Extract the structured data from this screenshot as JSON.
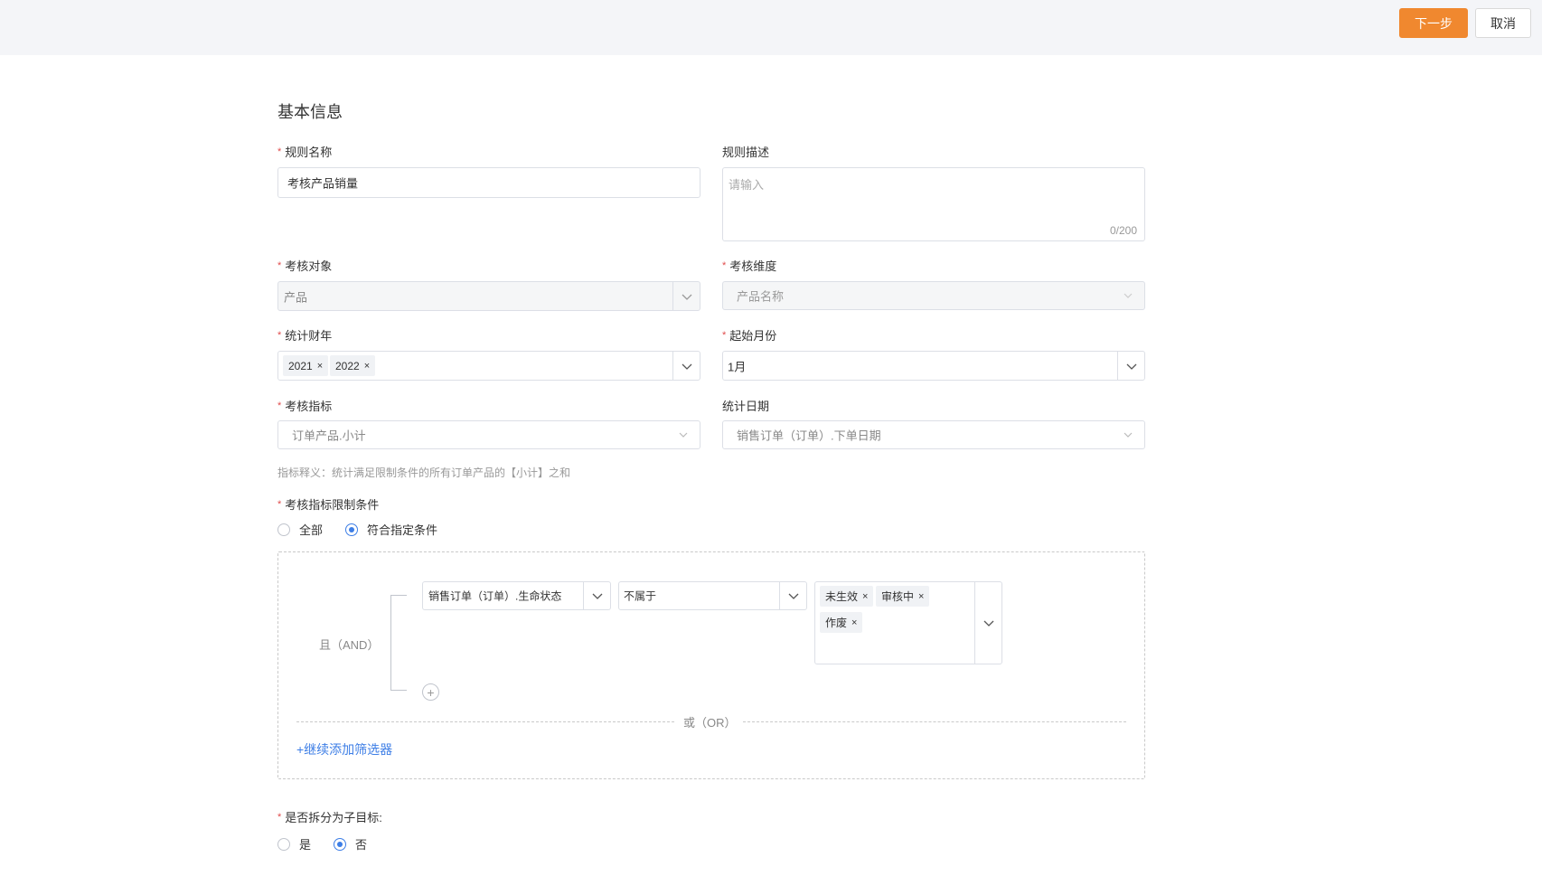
{
  "toolbar": {
    "next_label": "下一步",
    "cancel_label": "取消"
  },
  "section_title": "基本信息",
  "fields": {
    "rule_name": {
      "label": "规则名称",
      "value": "考核产品销量"
    },
    "rule_desc": {
      "label": "规则描述",
      "placeholder": "请输入",
      "counter": "0/200"
    },
    "assess_object": {
      "label": "考核对象",
      "value": "产品"
    },
    "assess_dimension": {
      "label": "考核维度",
      "value": "产品名称"
    },
    "fiscal_year": {
      "label": "统计财年",
      "tags": [
        "2021",
        "2022"
      ]
    },
    "start_month": {
      "label": "起始月份",
      "value": "1月"
    },
    "assess_metric": {
      "label": "考核指标",
      "value": "订单产品.小计"
    },
    "stat_date": {
      "label": "统计日期",
      "value": "销售订单（订单）.下单日期"
    }
  },
  "metric_hint": "指标释义：统计满足限制条件的所有订单产品的【小计】之和",
  "condition": {
    "label": "考核指标限制条件",
    "options": [
      "全部",
      "符合指定条件"
    ],
    "selected": "符合指定条件"
  },
  "filter": {
    "and_label": "且（AND）",
    "field_value": "销售订单（订单）.生命状态",
    "operator_value": "不属于",
    "value_tags": [
      "未生效",
      "审核中",
      "作废"
    ],
    "add_icon": "plus-circle-icon",
    "or_label": "或（OR）",
    "add_filter_label": "+继续添加筛选器"
  },
  "split": {
    "label": "是否拆分为子目标:",
    "options": [
      "是",
      "否"
    ],
    "selected": "否"
  },
  "colors": {
    "accent": "#f0882f",
    "link": "#3d7ee6",
    "required": "#e04b4b"
  }
}
